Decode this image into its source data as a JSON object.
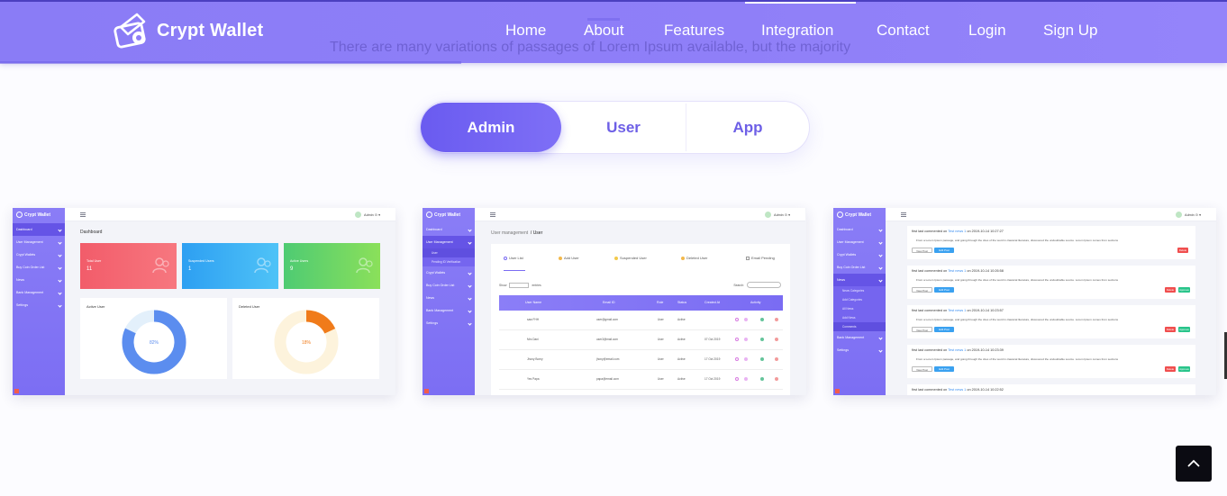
{
  "brand": {
    "name": "Crypt Wallet"
  },
  "nav": {
    "links": [
      "Home",
      "About",
      "Features",
      "Integration",
      "Contact",
      "Login",
      "Sign Up"
    ]
  },
  "background_text": "There are many variations of passages of Lorem Ipsum available, but the majority",
  "tabs": {
    "items": [
      "Admin",
      "User",
      "App"
    ],
    "active": "Admin"
  },
  "mini": {
    "brand": "Crypt Wallet",
    "admin": "Admin ⊙ ▾",
    "sidebar": [
      "Dashboard",
      "User Management",
      "Crypt Wallets",
      "Buy Coin Order List",
      "News",
      "Bank Management",
      "Settings"
    ],
    "sidebar_user_sub": [
      "User",
      "Pending ID Verification"
    ],
    "sidebar_news_sub": [
      "News Categories",
      "Add Categories",
      "All News",
      "Add News",
      "Comments"
    ]
  },
  "dashboard": {
    "title": "Dashboard",
    "stats": [
      {
        "label": "Total User",
        "value": "11",
        "color": "#f25c6a"
      },
      {
        "label": "Suspended Users",
        "value": "1",
        "color": "#30a9f2"
      },
      {
        "label": "Active Users",
        "value": "9",
        "color": "#5ed36a"
      }
    ],
    "panels": [
      {
        "title": "Active User",
        "percent": "82%",
        "value": 82,
        "color": "#5b8def"
      },
      {
        "title": "Deleted User",
        "percent": "18%",
        "value": 18,
        "color": "#f07b1a"
      }
    ]
  },
  "users": {
    "crumb_parent": "User management",
    "crumb_current": "/ User",
    "tabs": [
      "User List",
      "Add User",
      "Suspended User",
      "Deleted User",
      "Email Pending"
    ],
    "show_label": "Show",
    "entries_label": "entries",
    "search_label": "Search:",
    "columns": [
      "User Name",
      "Email ID",
      "Role",
      "Status",
      "Created At",
      "Activity"
    ],
    "rows": [
      {
        "name": "saw FHH",
        "email": "user@gmail.com",
        "role": "User",
        "status": "Active",
        "created": ""
      },
      {
        "name": "Mrs Dani",
        "email": "user3@mail.com",
        "role": "User",
        "status": "Active",
        "created": "07 Oct 2019"
      },
      {
        "name": "Jhony Bomy",
        "email": "jhony@email.com",
        "role": "User",
        "status": "Active",
        "created": "17 Oct 2019"
      },
      {
        "name": "Yes Papa",
        "email": "papa@email.com",
        "role": "User",
        "status": "Active",
        "created": "17 Oct 2019"
      }
    ]
  },
  "comments": {
    "prefix": "first last commented on",
    "news": "Test news 1",
    "body": "From a Lorem Ipsum passage, and going through the cites of the word in classical literature, discovered the undoubtable source. Lorem Ipsum comes from sections",
    "view_label": "View Post",
    "edit_label": "Edit Post",
    "delete_label": "Delete",
    "approve_label": "Approve",
    "items": [
      {
        "time": "on 2019-10-14 10:27:27",
        "approve": false
      },
      {
        "time": "on 2019-10-14 10:26:58",
        "approve": true
      },
      {
        "time": "on 2019-10-14 10:23:57",
        "approve": true
      },
      {
        "time": "on 2019-10-14 10:23:39",
        "approve": true
      },
      {
        "time": "on 2019-10-14 10:22:52",
        "approve": false
      }
    ]
  },
  "colors": {
    "accent": "#7a6cf3",
    "nav": "#8f7ff8"
  }
}
